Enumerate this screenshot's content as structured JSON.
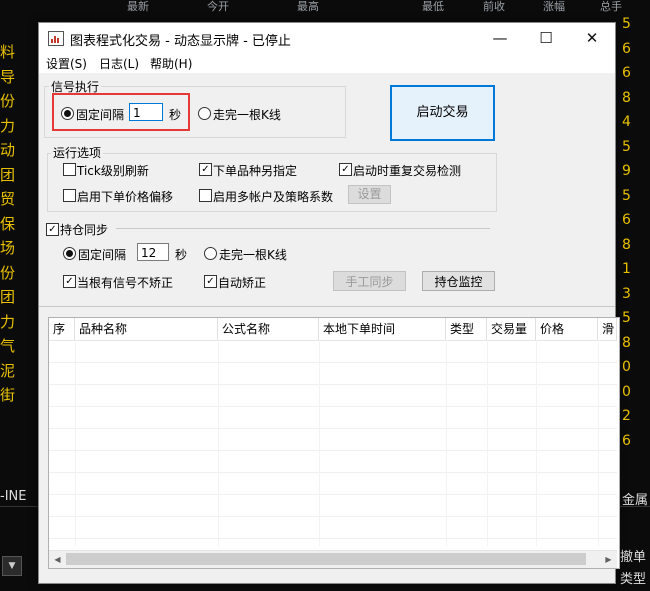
{
  "background": {
    "header_cols": [
      "最新",
      "今开",
      "最高",
      "最低",
      "前收",
      "涨幅",
      "总手"
    ],
    "left_column": [
      "料",
      "导",
      "份",
      "力",
      "动",
      "团",
      "贸",
      "保",
      "场",
      "份",
      "团",
      "力",
      "气",
      "泥",
      "街"
    ],
    "right_column": [
      "5",
      "6",
      "6",
      "8",
      "4",
      "5",
      "9",
      "5",
      "6",
      "8",
      "1",
      "3",
      "5",
      "8",
      "0",
      "0",
      "2",
      "6"
    ],
    "ine_label": "-INE",
    "jin_label": "金属",
    "cancel_label": "撤单",
    "type_label": "类型"
  },
  "window": {
    "title": "图表程式化交易 - 动态显示牌 - 已停止",
    "controls": {
      "minimize": "—",
      "maximize": "☐",
      "close": "✕"
    }
  },
  "menu": [
    "设置(S)",
    "日志(L)",
    "帮助(H)"
  ],
  "signal": {
    "group_label": "信号执行",
    "fixed_interval_label": "固定间隔",
    "interval_value": "1",
    "unit": "秒",
    "bar_label": "走完一根K线",
    "start_button": "启动交易"
  },
  "run_options": {
    "group_label": "运行选项",
    "tick_refresh": "Tick级别刷新",
    "order_product": "下单品种另指定",
    "restart_check": "启动时重复交易检测",
    "price_offset": "启用下单价格偏移",
    "multi_account": "启用多帐户及策略系数",
    "settings_button": "设置"
  },
  "position_sync": {
    "label": "持仓同步",
    "fixed_interval_label": "固定间隔",
    "interval_value": "12",
    "unit": "秒",
    "bar_label": "走完一根K线",
    "no_correct_when_signal": "当根有信号不矫正",
    "auto_correct": "自动矫正",
    "manual_sync_button": "手工同步",
    "monitor_button": "持仓监控"
  },
  "table": {
    "headers": [
      "序",
      "品种名称",
      "公式名称",
      "本地下单时间",
      "类型",
      "交易量",
      "价格",
      "滑"
    ]
  }
}
